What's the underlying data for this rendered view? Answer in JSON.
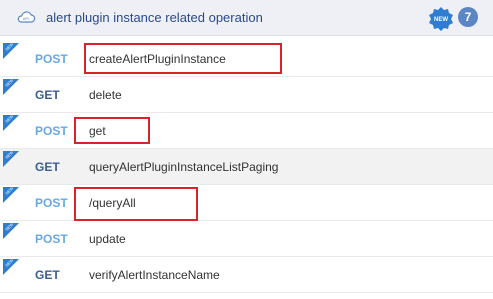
{
  "header": {
    "title": "alert plugin instance related operation",
    "new_badge": "NEW",
    "count": "7"
  },
  "endpoints": [
    {
      "method": "POST",
      "path": "createAlertPluginInstance",
      "badge": "NEW",
      "highlighted": true
    },
    {
      "method": "GET",
      "path": "delete",
      "badge": "NEW",
      "highlighted": false
    },
    {
      "method": "POST",
      "path": "get",
      "badge": "NEW",
      "highlighted": true
    },
    {
      "method": "GET",
      "path": "queryAlertPluginInstanceListPaging",
      "badge": "NEW",
      "highlighted": false
    },
    {
      "method": "POST",
      "path": "/queryAll",
      "badge": "NEW",
      "highlighted": true
    },
    {
      "method": "POST",
      "path": "update",
      "badge": "NEW",
      "highlighted": false
    },
    {
      "method": "GET",
      "path": "verifyAlertInstanceName",
      "badge": "NEW",
      "highlighted": false
    }
  ],
  "colors": {
    "post": "#6ba8e0",
    "get": "#3c5f8f",
    "highlight": "#d8232a",
    "badge": "#2f7dd1"
  }
}
